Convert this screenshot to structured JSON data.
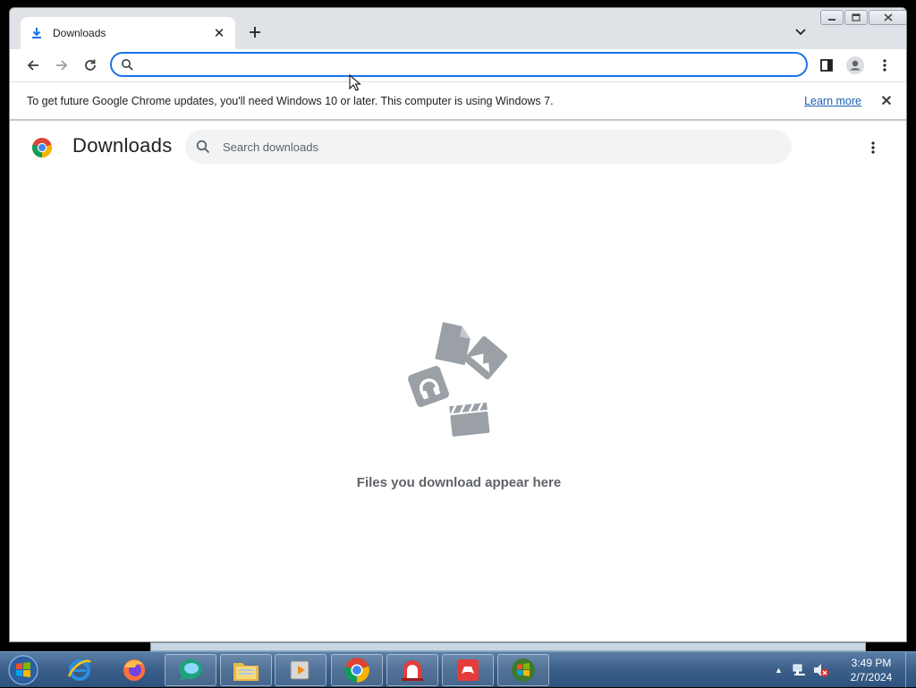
{
  "tab": {
    "title": "Downloads",
    "icon": "download-icon"
  },
  "omnibox": {
    "value": "",
    "placeholder": ""
  },
  "infobar": {
    "message": "To get future Google Chrome updates, you'll need Windows 10 or later. This computer is using Windows 7.",
    "link": "Learn more"
  },
  "page": {
    "title": "Downloads",
    "search_placeholder": "Search downloads",
    "empty_message": "Files you download appear here"
  },
  "taskbar": {
    "apps": [
      "internet-explorer-icon",
      "firefox-icon",
      "chat-app-icon",
      "file-explorer-icon",
      "media-player-icon",
      "chrome-icon",
      "red-app-icon",
      "game-app-icon",
      "windows-app-icon"
    ],
    "clock_time": "3:49 PM",
    "clock_date": "2/7/2024"
  },
  "colors": {
    "accent": "#1a73e8",
    "link": "#1a5fb4",
    "taskbar": "#3b5f89",
    "illustration": "#9aa0a6"
  }
}
